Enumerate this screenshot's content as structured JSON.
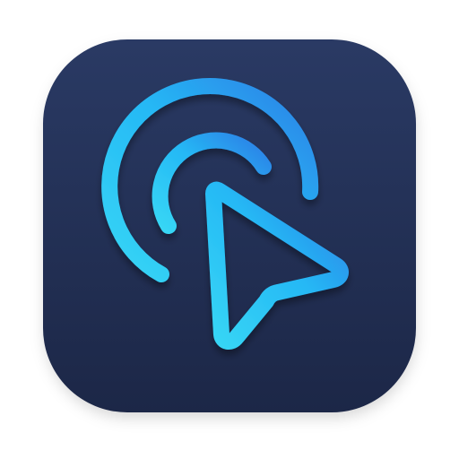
{
  "app_icon": {
    "name": "cursor-tap-app-icon",
    "icon": "cursor-with-signal-arcs-icon",
    "colors": {
      "background_top": "#2A3A64",
      "background_bottom": "#1C2747",
      "accent_light": "#37D6F5",
      "accent_mid": "#25B8F5",
      "accent_dark": "#2E7FE6"
    }
  }
}
